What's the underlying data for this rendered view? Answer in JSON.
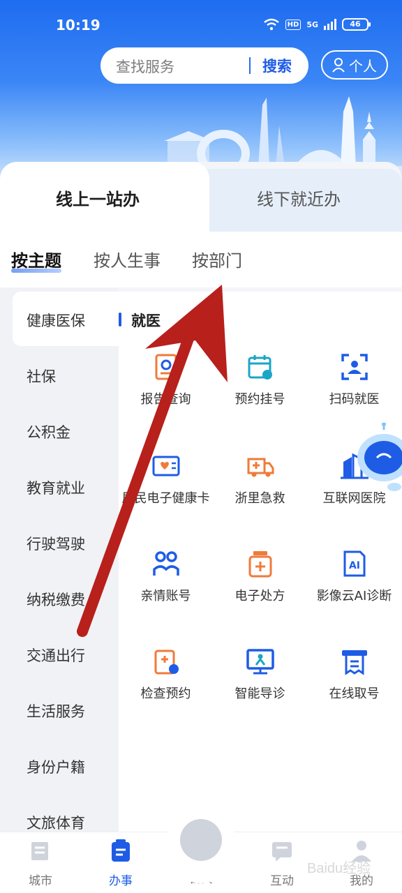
{
  "status_bar": {
    "time": "10:19",
    "network": "HD",
    "signal": "5G",
    "battery": "46"
  },
  "header": {
    "search_placeholder": "查找服务",
    "search_button": "搜索",
    "personal_label": "个人"
  },
  "main_tabs": [
    {
      "label": "线上一站办",
      "active": true
    },
    {
      "label": "线下就近办",
      "active": false
    }
  ],
  "sub_tabs": [
    {
      "label": "按主题",
      "active": true
    },
    {
      "label": "按人生事",
      "active": false
    },
    {
      "label": "按部门",
      "active": false
    }
  ],
  "sidebar": {
    "items": [
      {
        "label": "健康医保",
        "active": true
      },
      {
        "label": "社保"
      },
      {
        "label": "公积金"
      },
      {
        "label": "教育就业"
      },
      {
        "label": "行驶驾驶"
      },
      {
        "label": "纳税缴费"
      },
      {
        "label": "交通出行"
      },
      {
        "label": "生活服务"
      },
      {
        "label": "身份户籍"
      },
      {
        "label": "文旅体育"
      }
    ]
  },
  "section": {
    "title": "就医"
  },
  "services": [
    {
      "label": "报告查询",
      "icon": "report-icon"
    },
    {
      "label": "预约挂号",
      "icon": "calendar-icon"
    },
    {
      "label": "扫码就医",
      "icon": "scan-icon"
    },
    {
      "label": "居民电子健康卡",
      "icon": "health-card-icon"
    },
    {
      "label": "浙里急救",
      "icon": "ambulance-icon"
    },
    {
      "label": "互联网医院",
      "icon": "hospital-icon"
    },
    {
      "label": "亲情账号",
      "icon": "family-icon"
    },
    {
      "label": "电子处方",
      "icon": "prescription-icon"
    },
    {
      "label": "影像云AI诊断",
      "icon": "ai-icon"
    },
    {
      "label": "检查预约",
      "icon": "exam-icon"
    },
    {
      "label": "智能导诊",
      "icon": "guide-icon"
    },
    {
      "label": "在线取号",
      "icon": "ticket-icon"
    }
  ],
  "bottom_nav": [
    {
      "label": "城市",
      "active": false
    },
    {
      "label": "办事",
      "active": true
    },
    {
      "label": "首页",
      "active": false
    },
    {
      "label": "互动",
      "active": false
    },
    {
      "label": "我的",
      "active": false
    }
  ],
  "watermark": "Baidu经验",
  "colors": {
    "primary": "#1e5ce6",
    "orange": "#f07a3a",
    "arrow": "#b8201c"
  }
}
